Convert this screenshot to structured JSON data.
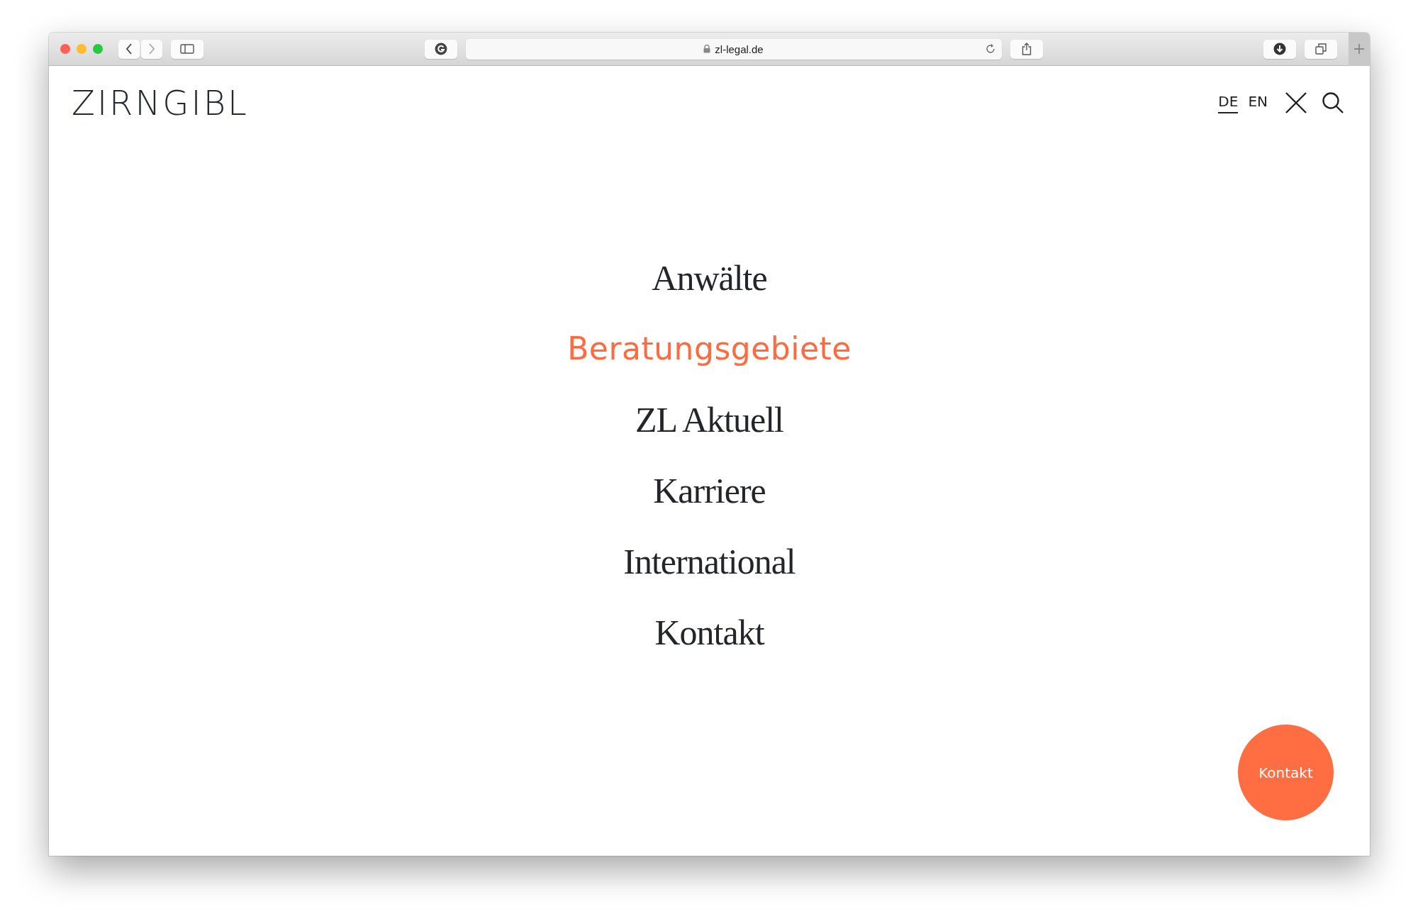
{
  "browser": {
    "url": "zl-legal.de"
  },
  "site": {
    "logo": "ZIRNGIBL"
  },
  "languages": [
    {
      "label": "DE",
      "selected": true
    },
    {
      "label": "EN",
      "selected": false
    }
  ],
  "menu": [
    {
      "label": "Anwälte",
      "selected": false
    },
    {
      "label": "Beratungsgebiete",
      "selected": true
    },
    {
      "label": "ZL Aktuell",
      "selected": false
    },
    {
      "label": "Karriere",
      "selected": false
    },
    {
      "label": "International",
      "selected": false
    },
    {
      "label": "Kontakt",
      "selected": false
    }
  ],
  "contact_button": {
    "label": "Kontakt"
  }
}
